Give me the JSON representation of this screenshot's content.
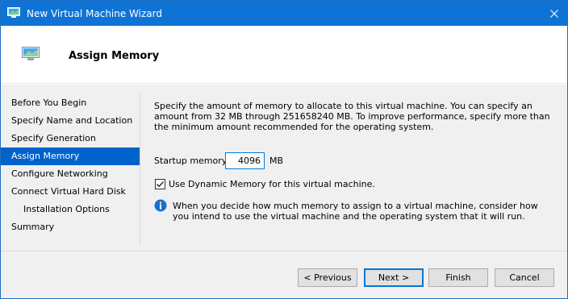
{
  "window": {
    "title": "New Virtual Machine Wizard"
  },
  "header": {
    "title": "Assign Memory"
  },
  "nav": {
    "items": [
      {
        "label": "Before You Begin",
        "selected": false,
        "indent": false
      },
      {
        "label": "Specify Name and Location",
        "selected": false,
        "indent": false
      },
      {
        "label": "Specify Generation",
        "selected": false,
        "indent": false
      },
      {
        "label": "Assign Memory",
        "selected": true,
        "indent": false
      },
      {
        "label": "Configure Networking",
        "selected": false,
        "indent": false
      },
      {
        "label": "Connect Virtual Hard Disk",
        "selected": false,
        "indent": false
      },
      {
        "label": "Installation Options",
        "selected": false,
        "indent": true
      },
      {
        "label": "Summary",
        "selected": false,
        "indent": false
      }
    ]
  },
  "content": {
    "description": "Specify the amount of memory to allocate to this virtual machine. You can specify an amount from 32 MB through 251658240 MB. To improve performance, specify more than the minimum amount recommended for the operating system.",
    "startup_memory_label": "Startup memory:",
    "startup_memory_value": "4096",
    "startup_memory_unit": "MB",
    "dynamic_memory_label": "Use Dynamic Memory for this virtual machine.",
    "dynamic_memory_checked": true,
    "info_text": "When you decide how much memory to assign to a virtual machine, consider how you intend to use the virtual machine and the operating system that it will run."
  },
  "footer": {
    "previous_label": "< Previous",
    "next_label": "Next >",
    "finish_label": "Finish",
    "cancel_label": "Cancel"
  },
  "colors": {
    "titlebar": "#0f73d6",
    "selection": "#0063cc",
    "panel": "#f0f0f0",
    "info_icon": "#1a6fd1"
  },
  "icons": {
    "app": "virtual-machine-icon",
    "header": "virtual-machine-icon",
    "close": "close-icon",
    "info": "info-icon",
    "check": "checkmark-icon"
  }
}
